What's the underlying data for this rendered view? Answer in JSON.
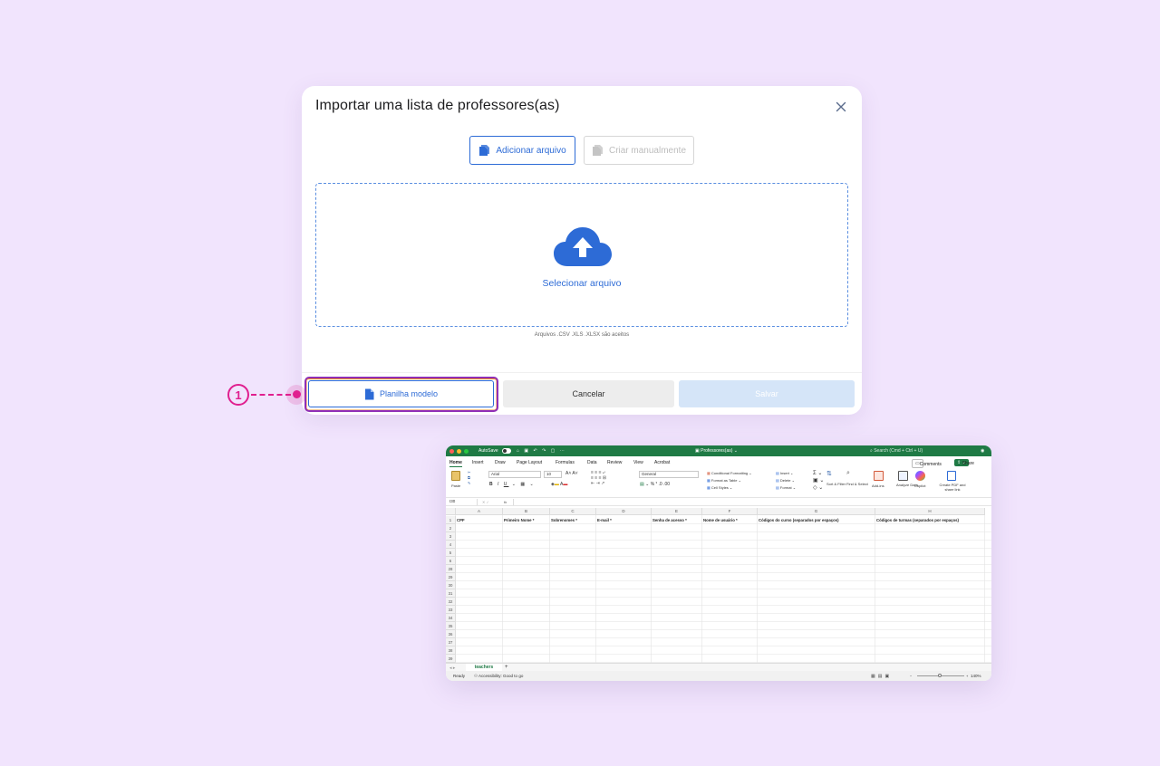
{
  "modal": {
    "title": "Importar uma lista de professores(as)",
    "add_file_label": "Adicionar arquivo",
    "create_manual_label": "Criar manualmente",
    "select_file_label": "Selecionar arquivo",
    "accepted_formats": "Arquivos .CSV .XLS .XLSX são aceitos",
    "template_label": "Planilha modelo",
    "cancel_label": "Cancelar",
    "save_label": "Salvar"
  },
  "callout": {
    "number": "1"
  },
  "colors": {
    "primary": "#2d6bd6",
    "callout": "#e01f8f",
    "excel_green": "#1f7a45",
    "background": "#f1e4fd"
  },
  "excel": {
    "autosave": "AutoSave",
    "doc_title": "Professores(as)",
    "search": "Search (Cmd + Ctrl + U)",
    "menu": [
      "Home",
      "Insert",
      "Draw",
      "Page Layout",
      "Formulas",
      "Data",
      "Review",
      "View",
      "Acrobat"
    ],
    "comments": "Comments",
    "share": "Share",
    "ribbon": {
      "paste": "Paste",
      "font": "Arial",
      "font_size": "10",
      "number_format": "General",
      "conditional_formatting": "Conditional Formatting",
      "format_as_table": "Format as Table",
      "cell_styles": "Cell Styles",
      "insert": "Insert",
      "delete": "Delete",
      "format": "Format",
      "sort_filter": "Sort & Filter",
      "find_select": "Find & Select",
      "addins": "Add-ins",
      "analyze_data": "Analyze Data",
      "copilot": "Copilot",
      "create_pdf": "Create PDF and share link"
    },
    "cell_ref": "I30",
    "fx": "fx",
    "columns": [
      "A",
      "B",
      "C",
      "D",
      "E",
      "F",
      "G",
      "H"
    ],
    "headers": [
      "CPF",
      "Primeiro Nome *",
      "Sobrenomes *",
      "E-mail *",
      "Senha de acesso *",
      "Nome de usuário *",
      "Códigos do curso (separados por espaços)",
      "Códigos de turmas (separados por espaços)"
    ],
    "rows": [
      "1",
      "2",
      "3",
      "4",
      "5",
      "6",
      "28",
      "29",
      "30",
      "31",
      "32",
      "33",
      "34",
      "35",
      "36",
      "37",
      "38",
      "39"
    ],
    "sheet_tab": "teachers",
    "add_sheet": "+",
    "status_ready": "Ready",
    "accessibility": "Accessibility: Good to go",
    "zoom": "140%"
  }
}
